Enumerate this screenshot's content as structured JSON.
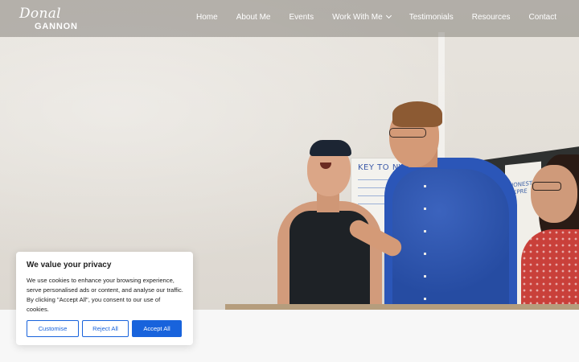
{
  "header": {
    "logo": {
      "script_text": "Donal",
      "caps_text": "GANNON"
    },
    "nav": [
      {
        "label": "Home"
      },
      {
        "label": "About Me"
      },
      {
        "label": "Events"
      },
      {
        "label": "Work With Me",
        "has_dropdown": true
      },
      {
        "label": "Testimonials"
      },
      {
        "label": "Resources"
      },
      {
        "label": "Contact"
      }
    ]
  },
  "hero": {
    "flipchart_title": "KEY TO NVC",
    "flipchart_side_text": "HONEST EXPRE"
  },
  "cookie_banner": {
    "title": "We value your privacy",
    "body": "We use cookies to enhance your browsing experience, serve personalised ads or content, and analyse our traffic. By clicking \"Accept All\", you consent to our use of cookies.",
    "customise_label": "Customise",
    "reject_label": "Reject All",
    "accept_label": "Accept All"
  },
  "colors": {
    "accent": "#1863dc",
    "banner_bg": "#ffffff",
    "text": "#212121",
    "page_bg": "#f7f7f7"
  }
}
